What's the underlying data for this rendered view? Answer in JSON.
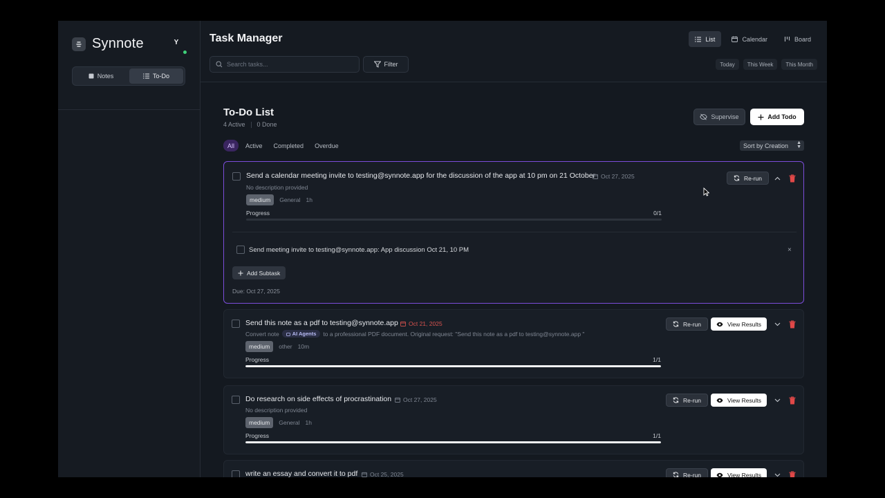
{
  "sidebar": {
    "brand": "Synnote",
    "avatar_initial": "Y",
    "segments": [
      {
        "label": "Notes",
        "icon": "note-icon",
        "active": false
      },
      {
        "label": "To-Do",
        "icon": "list-icon",
        "active": true
      }
    ]
  },
  "header": {
    "title": "Task Manager",
    "search_placeholder": "Search tasks...",
    "filter_label": "Filter",
    "views": [
      {
        "label": "List",
        "icon": "list-icon",
        "active": true
      },
      {
        "label": "Calendar",
        "icon": "calendar-icon",
        "active": false
      },
      {
        "label": "Board",
        "icon": "board-icon",
        "active": false
      }
    ],
    "ranges": [
      "Today",
      "This Week",
      "This Month"
    ]
  },
  "list": {
    "title": "To-Do List",
    "active_count": "4 Active",
    "done_count": "0 Done",
    "supervise_label": "Supervise",
    "add_todo_label": "Add Todo",
    "tabs": [
      {
        "label": "All",
        "active": true
      },
      {
        "label": "Active",
        "active": false
      },
      {
        "label": "Completed",
        "active": false
      },
      {
        "label": "Overdue",
        "active": false
      }
    ],
    "sort_label": "Sort by Creation"
  },
  "tasks": [
    {
      "title": "Send a calendar meeting invite to testing@synnote.app for the discussion of the app at 10 pm on 21 October",
      "date": "Oct 27, 2025",
      "overdue": false,
      "description": "No description provided",
      "priority": "medium",
      "category": "General",
      "duration": "1h",
      "progress_label": "Progress",
      "progress_text": "0/1",
      "progress": 0,
      "rerun_label": "Re-run",
      "expanded": true,
      "subtask": "Send meeting invite to testing@synnote.app: App discussion Oct 21, 10 PM",
      "add_subtask_label": "Add Subtask",
      "due": "Due: Oct 27, 2025"
    },
    {
      "title": "Send this note as a pdf to testing@synnote.app",
      "date": "Oct 21, 2025",
      "overdue": true,
      "desc_prefix": "Convert note",
      "agent_label": "AI Agents",
      "desc_suffix": "to a professional PDF document. Original request: \"Send this note as a pdf to testing@synnote.app \"",
      "priority": "medium",
      "category": "other",
      "duration": "10m",
      "progress_label": "Progress",
      "progress_text": "1/1",
      "progress": 1,
      "rerun_label": "Re-run",
      "view_results_label": "View Results"
    },
    {
      "title": "Do research on side effects of procrastination",
      "date": "Oct 27, 2025",
      "overdue": false,
      "description": "No description provided",
      "priority": "medium",
      "category": "General",
      "duration": "1h",
      "progress_label": "Progress",
      "progress_text": "1/1",
      "progress": 1,
      "rerun_label": "Re-run",
      "view_results_label": "View Results"
    },
    {
      "title": "write an essay and convert it to pdf",
      "date": "Oct 25, 2025",
      "overdue": false,
      "rerun_label": "Re-run",
      "view_results_label": "View Results"
    }
  ],
  "colors": {
    "accent": "#7c4ddb",
    "overdue": "#d9534f",
    "delete": "#e04848",
    "online": "#3fd17a"
  }
}
